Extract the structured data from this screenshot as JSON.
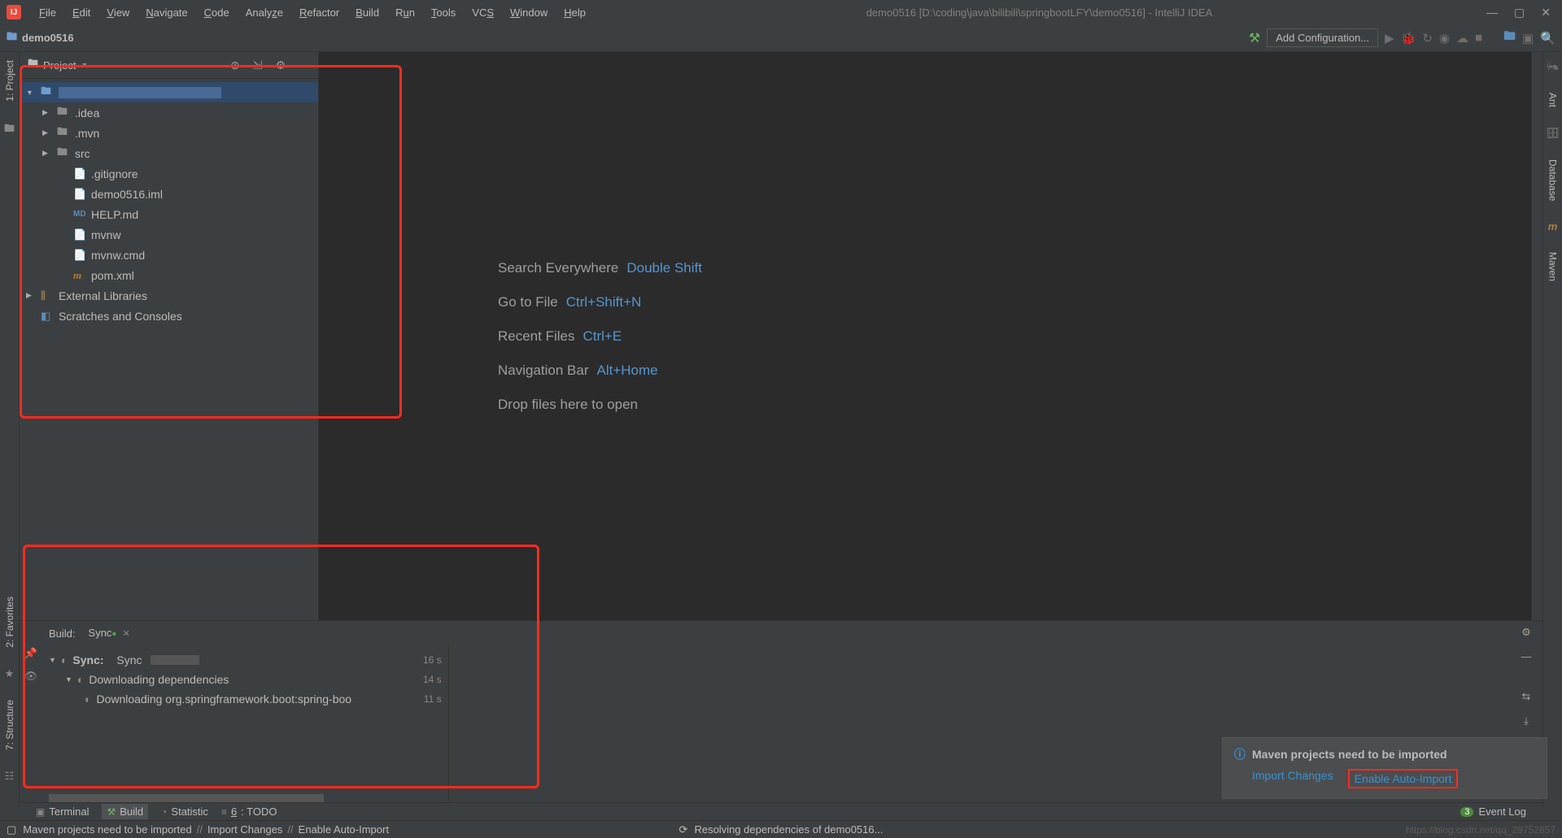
{
  "title": "demo0516 [D:\\coding\\java\\bilibili\\springbootLFY\\demo0516] - IntelliJ IDEA",
  "menu": [
    "File",
    "Edit",
    "View",
    "Navigate",
    "Code",
    "Analyze",
    "Refactor",
    "Build",
    "Run",
    "Tools",
    "VCS",
    "Window",
    "Help"
  ],
  "breadcrumb": "demo0516",
  "config_button": "Add Configuration...",
  "project_panel": {
    "title": "Project",
    "tree": {
      "root_blur": " ",
      "items": [
        {
          "label": ".idea",
          "type": "folder",
          "expandable": true
        },
        {
          "label": ".mvn",
          "type": "folder",
          "expandable": true
        },
        {
          "label": "src",
          "type": "folder",
          "expandable": true
        },
        {
          "label": ".gitignore",
          "type": "file"
        },
        {
          "label": "demo0516.iml",
          "type": "file"
        },
        {
          "label": "HELP.md",
          "type": "md"
        },
        {
          "label": "mvnw",
          "type": "file"
        },
        {
          "label": "mvnw.cmd",
          "type": "file"
        },
        {
          "label": "pom.xml",
          "type": "xml"
        }
      ],
      "ext_lib": "External Libraries",
      "scratches": "Scratches and Consoles"
    }
  },
  "welcome": [
    {
      "label": "Search Everywhere",
      "shortcut": "Double Shift"
    },
    {
      "label": "Go to File",
      "shortcut": "Ctrl+Shift+N"
    },
    {
      "label": "Recent Files",
      "shortcut": "Ctrl+E"
    },
    {
      "label": "Navigation Bar",
      "shortcut": "Alt+Home"
    },
    {
      "label": "Drop files here to open",
      "shortcut": ""
    }
  ],
  "build": {
    "label": "Build:",
    "tab": "Sync",
    "sync_root": {
      "bold": "Sync:",
      "tail": "Sync",
      "time": "16 s"
    },
    "sync_dl": {
      "label": "Downloading dependencies",
      "time": "14 s"
    },
    "sync_dep": {
      "label": "Downloading org.springframework.boot:spring-boo",
      "time": "11 s"
    }
  },
  "notif": {
    "title": "Maven projects need to be imported",
    "link1": "Import Changes",
    "link2": "Enable Auto-Import"
  },
  "bottom_tabs": {
    "terminal": "Terminal",
    "build": "Build",
    "statistic": "Statistic",
    "todo_u": "6",
    "todo": ": TODO",
    "event_log": "Event Log",
    "event_count": "3"
  },
  "left_tabs": {
    "project": "1: Project",
    "favorites": "2: Favorites",
    "structure": "7: Structure"
  },
  "right_tabs": {
    "ant": "Ant",
    "database": "Database",
    "maven": "Maven"
  },
  "status": {
    "msg": "Maven projects need to be imported",
    "l1": "Import Changes",
    "l2": "Enable Auto-Import",
    "center": "Resolving dependencies of demo0516...",
    "watermark": "https://blog.csdn.net/qq_29752857"
  }
}
